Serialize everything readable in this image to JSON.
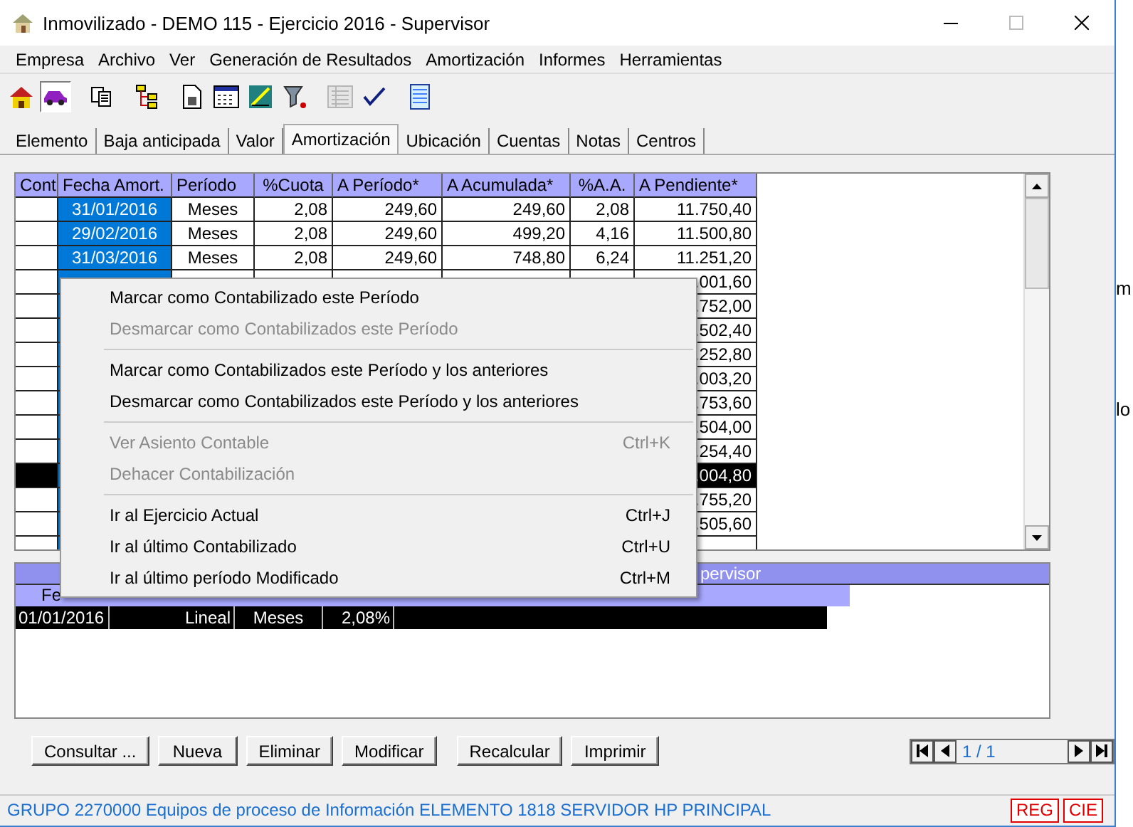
{
  "window": {
    "title": "Inmovilizado - DEMO 115 - Ejercicio 2016 - Supervisor"
  },
  "menu_bar": [
    "Empresa",
    "Archivo",
    "Ver",
    "Generación de Resultados",
    "Amortización",
    "Informes",
    "Herramientas"
  ],
  "toolbar": [
    {
      "kind": "house",
      "pressed": false,
      "disabled": false
    },
    {
      "kind": "car",
      "pressed": true,
      "disabled": false
    },
    {
      "kind": "copy",
      "pressed": false,
      "disabled": false
    },
    {
      "kind": "tree",
      "pressed": false,
      "disabled": false
    },
    {
      "kind": "document",
      "pressed": false,
      "disabled": false
    },
    {
      "kind": "calendar",
      "pressed": false,
      "disabled": false
    },
    {
      "kind": "chart",
      "pressed": false,
      "disabled": false
    },
    {
      "kind": "funnel",
      "pressed": false,
      "disabled": false
    },
    {
      "kind": "list",
      "pressed": false,
      "disabled": true
    },
    {
      "kind": "check",
      "pressed": false,
      "disabled": false
    },
    {
      "kind": "notebook",
      "pressed": false,
      "disabled": false
    }
  ],
  "tabs": [
    {
      "label": "Elemento",
      "selected": false
    },
    {
      "label": "Baja anticipada",
      "selected": false
    },
    {
      "label": "Valor",
      "selected": false
    },
    {
      "label": "Amortización",
      "selected": true
    },
    {
      "label": "Ubicación",
      "selected": false
    },
    {
      "label": "Cuentas",
      "selected": false
    },
    {
      "label": "Notas",
      "selected": false
    },
    {
      "label": "Centros",
      "selected": false
    }
  ],
  "grid": {
    "columns": [
      "Cont",
      "Fecha Amort.",
      "Período",
      "%Cuota",
      "A Período*",
      "A Acumulada*",
      "%A.A.",
      "A Pendiente*"
    ],
    "rows": [
      {
        "date": "31/01/2016",
        "period": "Meses",
        "quota": "2,08",
        "period_amount": "249,60",
        "accumulated": "249,60",
        "accumulated_pct": "2,08",
        "pending": "11.750,40",
        "selected": false
      },
      {
        "date": "29/02/2016",
        "period": "Meses",
        "quota": "2,08",
        "period_amount": "249,60",
        "accumulated": "499,20",
        "accumulated_pct": "4,16",
        "pending": "11.500,80",
        "selected": false
      },
      {
        "date": "31/03/2016",
        "period": "Meses",
        "quota": "2,08",
        "period_amount": "249,60",
        "accumulated": "748,80",
        "accumulated_pct": "6,24",
        "pending": "11.251,20",
        "selected": false
      },
      {
        "pending": ".001,60",
        "selected": false
      },
      {
        "pending": ".752,00",
        "selected": false
      },
      {
        "pending": ".502,40",
        "selected": false
      },
      {
        "pending": ".252,80",
        "selected": false
      },
      {
        "pending": ".003,20",
        "selected": false
      },
      {
        "pending": ".753,60",
        "selected": false
      },
      {
        "pending": ".504,00",
        "selected": false
      },
      {
        "pending": ".254,40",
        "selected": false
      },
      {
        "pending": ".004,80",
        "selected": true
      },
      {
        "pending": ".755,20",
        "selected": false
      },
      {
        "pending": ".505,60",
        "selected": false
      },
      {
        "selected": false
      }
    ]
  },
  "context_menu": [
    {
      "kind": "item",
      "label": "Marcar como Contabilizado este Período",
      "enabled": true
    },
    {
      "kind": "item",
      "label": "Desmarcar como Contabilizados este Período",
      "enabled": false
    },
    {
      "kind": "separator"
    },
    {
      "kind": "item",
      "label": "Marcar como Contabilizados este Período y los anteriores",
      "enabled": true
    },
    {
      "kind": "item",
      "label": "Desmarcar como Contabilizados este Período y los anteriores",
      "enabled": true
    },
    {
      "kind": "separator"
    },
    {
      "kind": "item",
      "label": "Ver Asiento Contable",
      "shortcut": "Ctrl+K",
      "enabled": false
    },
    {
      "kind": "item",
      "label": "Dehacer Contabilización",
      "enabled": false
    },
    {
      "kind": "separator"
    },
    {
      "kind": "item",
      "label": "Ir al Ejercicio Actual",
      "shortcut": "Ctrl+J",
      "enabled": true
    },
    {
      "kind": "item",
      "label": "Ir al último Contabilizado",
      "shortcut": "Ctrl+U",
      "enabled": true
    },
    {
      "kind": "item",
      "label": "Ir al último período Modificado",
      "shortcut": "Ctrl+M",
      "enabled": true
    }
  ],
  "bottom_grid": {
    "header_text": "pervisor",
    "column_header": "Fe",
    "rows": [
      {
        "cells": [
          "01/01/2016",
          "Lineal",
          "Meses",
          "2,08%"
        ],
        "selected": true
      }
    ]
  },
  "buttons": [
    "Consultar ...",
    "Nueva",
    "Eliminar",
    "Modificar",
    "Recalcular",
    "Imprimir"
  ],
  "navigator": {
    "position": "1 / 1"
  },
  "status_bar": {
    "text": "GRUPO 2270000 Equipos de proceso de Información ELEMENTO 1818 SERVIDOR HP PRINCIPAL",
    "indicators": [
      "REG",
      "CIE"
    ]
  },
  "background_window": {
    "texts": [
      "m",
      "lo"
    ]
  }
}
